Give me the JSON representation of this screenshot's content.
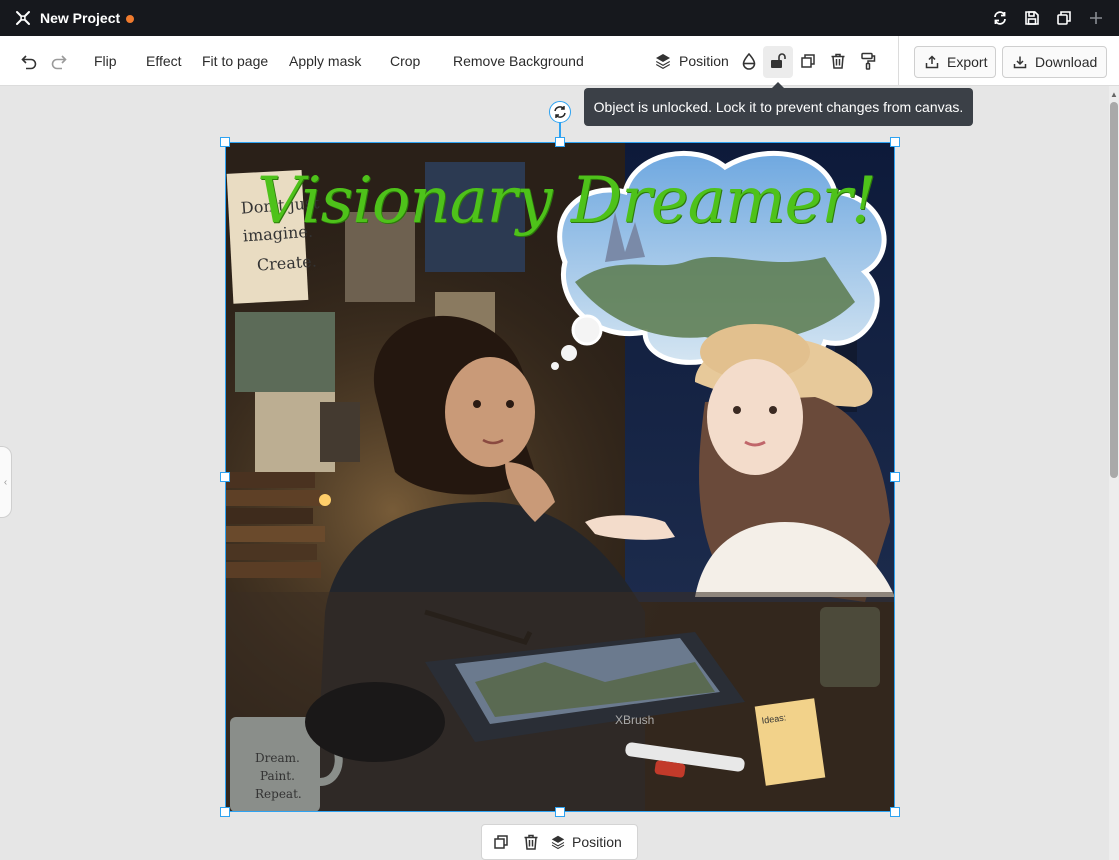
{
  "window": {
    "title": "New Project",
    "actions": [
      "refresh-icon",
      "save-icon",
      "duplicate-icon",
      "plus-icon"
    ]
  },
  "toolbar": {
    "undo_icon": "undo-icon",
    "redo_icon": "redo-icon",
    "flip": "Flip",
    "effect": "Effect",
    "fit_to_page": "Fit to page",
    "apply_mask": "Apply mask",
    "crop": "Crop",
    "remove_background": "Remove Background",
    "position": "Position",
    "export": "Export",
    "download": "Download"
  },
  "tooltip": {
    "text": "Object is unlocked. Lock it to prevent changes from canvas."
  },
  "canvas": {
    "headline": "Visionary Dreamer!",
    "selection_color": "#2ea3f2",
    "headline_color": "#4ec21a"
  },
  "floating_toolbar": {
    "position": "Position"
  },
  "colors": {
    "titlebar": "#16181d",
    "dirty_indicator": "#f07b2e",
    "tooltip_bg": "#3b4047"
  }
}
